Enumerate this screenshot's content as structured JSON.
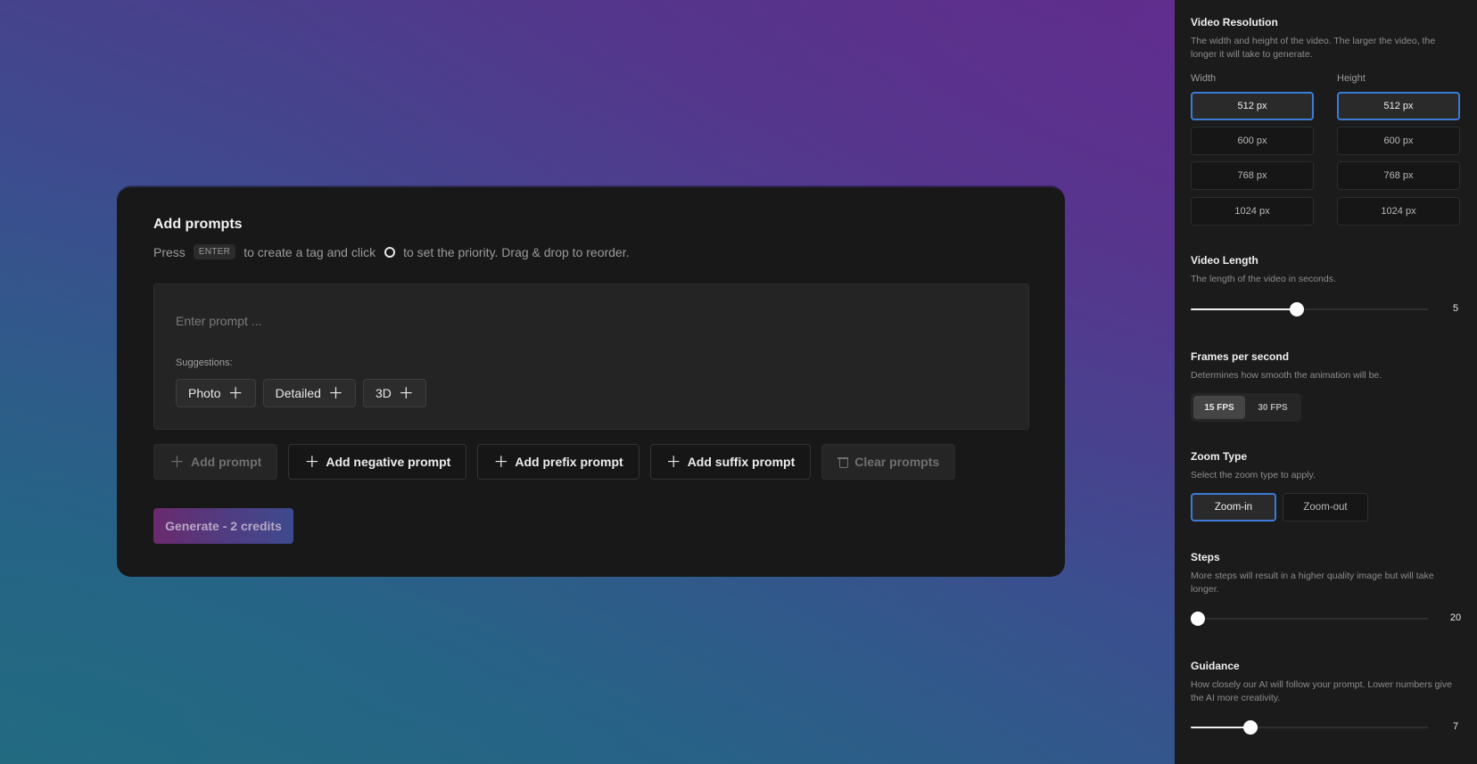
{
  "main": {
    "title": "Add prompts",
    "desc_press": "Press",
    "desc_key": "ENTER",
    "desc_mid": "to create a tag and click",
    "desc_end": "to set the priority. Drag & drop to reorder.",
    "prompt_placeholder": "Enter prompt ...",
    "suggestions_label": "Suggestions:",
    "suggestions": [
      "Photo",
      "Detailed",
      "3D"
    ],
    "actions": {
      "add_prompt": "Add prompt",
      "add_negative": "Add negative prompt",
      "add_prefix": "Add prefix prompt",
      "add_suffix": "Add suffix prompt",
      "clear": "Clear prompts"
    },
    "generate_label": "Generate - 2 credits"
  },
  "sidebar": {
    "resolution": {
      "title": "Video Resolution",
      "desc": "The width and height of the video. The larger the video, the longer it will take to generate.",
      "width_label": "Width",
      "height_label": "Height",
      "options": [
        "512 px",
        "600 px",
        "768 px",
        "1024 px"
      ],
      "selected_width": "512 px",
      "selected_height": "512 px"
    },
    "length": {
      "title": "Video Length",
      "desc": "The length of the video in seconds.",
      "value": "5",
      "fraction": 0.448
    },
    "fps": {
      "title": "Frames per second",
      "desc": "Determines how smooth the animation will be.",
      "options": [
        "15 FPS",
        "30 FPS"
      ],
      "selected": "15 FPS"
    },
    "zoom": {
      "title": "Zoom Type",
      "desc": "Select the zoom type to apply.",
      "options": [
        "Zoom-in",
        "Zoom-out"
      ],
      "selected": "Zoom-in"
    },
    "steps": {
      "title": "Steps",
      "desc": "More steps will result in a higher quality image but will take longer.",
      "value": "20",
      "fraction": 0.03
    },
    "guidance": {
      "title": "Guidance",
      "desc": "How closely our AI will follow your prompt. Lower numbers give the AI more creativity.",
      "value": "7",
      "fraction": 0.25
    }
  },
  "colors": {
    "accent": "#3d7ad6",
    "panel": "#1b1b1b",
    "card": "#181818"
  }
}
